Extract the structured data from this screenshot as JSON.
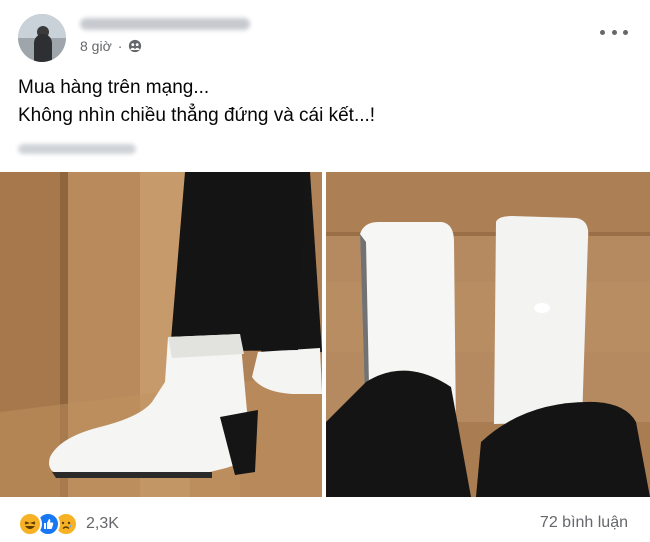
{
  "post": {
    "author_name": "",
    "time": "8 giờ",
    "privacy_icon": "friends-icon",
    "caption_line1": "Mua hàng trên mạng...",
    "caption_line2": "Không nhìn chiều thẳng đứng và cái kết...!",
    "tagged_name": ""
  },
  "footer": {
    "reaction_icons": [
      "haha-icon",
      "like-icon",
      "sad-icon"
    ],
    "reaction_count": "2,3K",
    "comment_count": "72 bình luận"
  },
  "colors": {
    "like_blue": "#1877f2",
    "reaction_yellow": "#f7b125",
    "secondary_text": "#65676b"
  }
}
